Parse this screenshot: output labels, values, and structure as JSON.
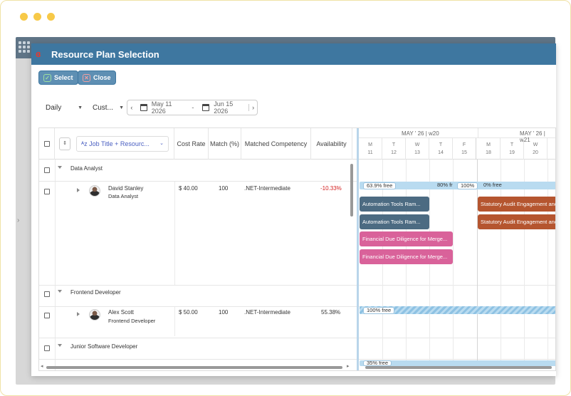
{
  "dialog": {
    "title": "Resource Plan Selection",
    "select_label": "Select",
    "close_label": "Close"
  },
  "filters": {
    "granularity": "Daily",
    "range_type": "Cust...",
    "start_date": "May 11 2026",
    "end_date": "Jun 15 2026",
    "date_separator": "-"
  },
  "grid": {
    "group_by": "Job Title + Resourc...",
    "columns": [
      "Cost Rate",
      "Match (%)",
      "Matched Competency",
      "Availability"
    ],
    "groups": [
      {
        "title": "Data Analyst",
        "resource": {
          "name": "David Stanley",
          "role": "Data Analyst",
          "cost": "$ 40.00",
          "match": "100",
          "competency": ".NET-Intermediate",
          "availability": "-10.33%"
        }
      },
      {
        "title": "Frontend Developer",
        "resource": {
          "name": "Alex Scott",
          "role": "Frontend Developer",
          "cost": "$ 50.00",
          "match": "100",
          "competency": ".NET-Intermediate",
          "availability": "55.38%"
        }
      },
      {
        "title": "Junior Software Developer"
      }
    ]
  },
  "timeline": {
    "weeks": [
      "MAY ' 26 | w20",
      "MAY ' 26 | w21"
    ],
    "days": [
      {
        "dow": "M",
        "date": "11"
      },
      {
        "dow": "T",
        "date": "12"
      },
      {
        "dow": "W",
        "date": "13"
      },
      {
        "dow": "T",
        "date": "14"
      },
      {
        "dow": "F",
        "date": "15"
      },
      {
        "dow": "M",
        "date": "18"
      },
      {
        "dow": "T",
        "date": "19"
      },
      {
        "dow": "W",
        "date": "20"
      }
    ],
    "availability_pills": [
      "63.9% free",
      "80% fr",
      "100%",
      "0% free"
    ],
    "tasks": {
      "automation_1": "Automation Tools Ram...",
      "automation_2": "Automation Tools Ram...",
      "financial_1": "Financial Due Diligence for Merge...",
      "financial_2": "Financial Due Diligence for Merge...",
      "statutory_1": "Statutory Audit Engagement and",
      "statutory_2": "Statutory Audit Engagement and"
    },
    "row2_pill": "100% free",
    "row3_pill": "35% free"
  },
  "colors": {
    "header": "#3e77a0",
    "automation": "#4c6b82",
    "financial": "#d9629a",
    "statutory": "#b5552f",
    "negative": "#d42020"
  }
}
